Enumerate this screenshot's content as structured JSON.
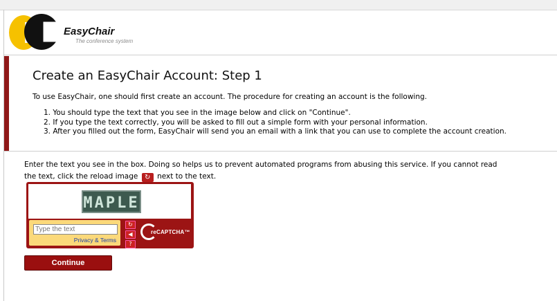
{
  "header": {
    "logo_name": "EasyChair",
    "logo_tagline": "The conference system"
  },
  "page": {
    "title": "Create an EasyChair Account: Step 1",
    "intro": "To use EasyChair, one should first create an account. The procedure for creating an account is the following.",
    "steps": [
      "1. You should type the text that you see in the image below and click on \"Continue\".",
      "2. If you type the text correctly, you will be asked to fill out a simple form with your personal information.",
      "3. After you filled out the form, EasyChair will send you an email with a link that you can use to complete the account creation."
    ],
    "notice_before_icon": "Enter the text you see in the box. Doing so helps us to prevent automated programs from abusing this service. If you cannot read the text, click the reload image",
    "notice_after_icon": "next to the text."
  },
  "captcha": {
    "challenge_text": "MAPLE",
    "input_placeholder": "Type the text",
    "input_value": "",
    "privacy_link": "Privacy & Terms",
    "brand": "reCAPTCHA™",
    "icons": [
      "reload-icon",
      "audio-icon",
      "help-icon"
    ]
  },
  "actions": {
    "continue_label": "Continue"
  },
  "colors": {
    "accent_red": "#9a0f0f",
    "captcha_panel": "#fbd97a",
    "logo_yellow": "#f6c100"
  }
}
